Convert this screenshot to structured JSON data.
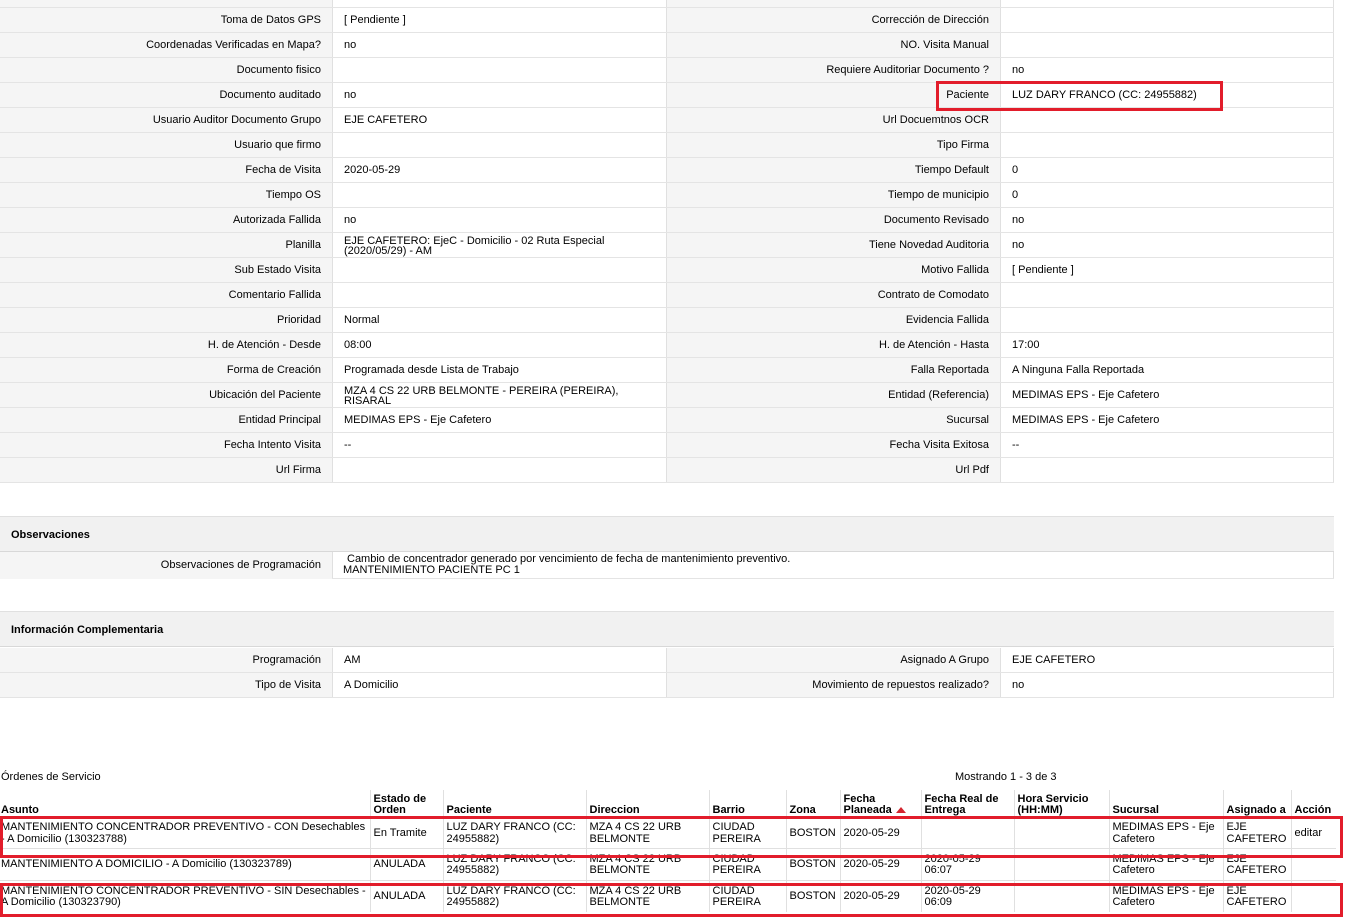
{
  "details": {
    "rows": [
      {
        "l1": "Toma de Datos GPS",
        "v1": "[ Pendiente ]",
        "l2": "Corrección de Dirección",
        "v2": ""
      },
      {
        "l1": "Coordenadas Verificadas en Mapa?",
        "v1": "no",
        "l2": "NO. Visita Manual",
        "v2": ""
      },
      {
        "l1": "Documento fisico",
        "v1": "",
        "l2": "Requiere Auditoriar Documento ?",
        "v2": "no"
      },
      {
        "l1": "Documento auditado",
        "v1": "no",
        "l2": "Paciente",
        "v2": "LUZ DARY FRANCO (CC: 24955882)"
      },
      {
        "l1": "Usuario Auditor Documento Grupo",
        "v1": "EJE CAFETERO",
        "l2": "Url Docuemtnos OCR",
        "v2": ""
      },
      {
        "l1": "Usuario que firmo",
        "v1": "",
        "l2": "Tipo Firma",
        "v2": ""
      },
      {
        "l1": "Fecha de Visita",
        "v1": "2020-05-29",
        "l2": "Tiempo Default",
        "v2": "0"
      },
      {
        "l1": "Tiempo OS",
        "v1": "",
        "l2": "Tiempo de municipio",
        "v2": "0"
      },
      {
        "l1": "Autorizada Fallida",
        "v1": "no",
        "l2": "Documento Revisado",
        "v2": "no"
      },
      {
        "l1": "Planilla",
        "v1": "EJE CAFETERO: EjeC - Domicilio - 02 Ruta Especial (2020/05/29) - AM",
        "l2": "Tiene Novedad Auditoria",
        "v2": "no"
      },
      {
        "l1": "Sub Estado Visita",
        "v1": "",
        "l2": "Motivo Fallida",
        "v2": "[ Pendiente ]"
      },
      {
        "l1": "Comentario Fallida",
        "v1": "",
        "l2": "Contrato de Comodato",
        "v2": ""
      },
      {
        "l1": "Prioridad",
        "v1": "Normal",
        "l2": "Evidencia Fallida",
        "v2": ""
      },
      {
        "l1": "H. de Atención - Desde",
        "v1": "08:00",
        "l2": "H. de Atención - Hasta",
        "v2": "17:00"
      },
      {
        "l1": "Forma de Creación",
        "v1": "Programada desde Lista de Trabajo",
        "l2": "Falla Reportada",
        "v2": "A Ninguna Falla Reportada"
      },
      {
        "l1": "Ubicación del Paciente",
        "v1": "MZA 4 CS 22 URB BELMONTE - PEREIRA (PEREIRA), RISARAL",
        "l2": "Entidad (Referencia)",
        "v2": "MEDIMAS EPS - Eje Cafetero"
      },
      {
        "l1": "Entidad Principal",
        "v1": "MEDIMAS EPS - Eje Cafetero",
        "l2": "Sucursal",
        "v2": "MEDIMAS EPS - Eje Cafetero"
      },
      {
        "l1": "Fecha Intento Visita",
        "v1": "--",
        "l2": "Fecha Visita Exitosa",
        "v2": "--"
      },
      {
        "l1": "Url Firma",
        "v1": "",
        "l2": "Url Pdf",
        "v2": ""
      }
    ]
  },
  "observaciones": {
    "title": "Observaciones",
    "label": "Observaciones de Programación",
    "line1": "Cambio de concentrador generado por vencimiento de fecha de mantenimiento preventivo.",
    "line2": "MANTENIMIENTO PACIENTE PC 1"
  },
  "complementaria": {
    "title": "Información Complementaria",
    "rows": [
      {
        "l1": "Programación",
        "v1": "AM",
        "l2": "Asignado A Grupo",
        "v2": "EJE CAFETERO"
      },
      {
        "l1": "Tipo de Visita",
        "v1": "A Domicilio",
        "l2": "Movimiento de repuestos realizado?",
        "v2": "no"
      }
    ]
  },
  "ordenes": {
    "title": "Órdenes de Servicio",
    "count": "Mostrando 1 - 3 de 3",
    "headers": [
      "Asunto",
      "Estado de Orden",
      "Paciente",
      "Direccion",
      "Barrio",
      "Zona",
      "Fecha Planeada",
      "Fecha Real de Entrega",
      "Hora Servicio (HH:MM)",
      "Sucursal",
      "Asignado a",
      "Acción"
    ],
    "rows": [
      {
        "asunto": "MANTENIMIENTO CONCENTRADOR PREVENTIVO - CON Desechables - A Domicilio (130323788)",
        "estado": "En Tramite",
        "paciente": "LUZ DARY FRANCO (CC: 24955882)",
        "direccion": "MZA 4 CS 22 URB BELMONTE",
        "barrio": "CIUDAD PEREIRA",
        "zona": "BOSTON",
        "fecha_planeada": "2020-05-29",
        "fecha_real": "",
        "hora": "",
        "sucursal": "MEDIMAS EPS - Eje Cafetero",
        "asignado": "EJE CAFETERO",
        "accion": "editar"
      },
      {
        "asunto": "MANTENIMIENTO A DOMICILIO - A Domicilio (130323789)",
        "estado": "ANULADA",
        "paciente": "LUZ DARY FRANCO (CC: 24955882)",
        "direccion": "MZA 4 CS 22 URB BELMONTE",
        "barrio": "CIUDAD PEREIRA",
        "zona": "BOSTON",
        "fecha_planeada": "2020-05-29",
        "fecha_real": "2020-05-29 06:07",
        "hora": "",
        "sucursal": "MEDIMAS EPS - Eje Cafetero",
        "asignado": "EJE CAFETERO",
        "accion": ""
      },
      {
        "asunto": "MANTENIMIENTO CONCENTRADOR PREVENTIVO - SIN Desechables - A Domicilio (130323790)",
        "estado": "ANULADA",
        "paciente": "LUZ DARY FRANCO (CC: 24955882)",
        "direccion": "MZA 4 CS 22 URB BELMONTE",
        "barrio": "CIUDAD PEREIRA",
        "zona": "BOSTON",
        "fecha_planeada": "2020-05-29",
        "fecha_real": "2020-05-29 06:09",
        "hora": "",
        "sucursal": "MEDIMAS EPS - Eje Cafetero",
        "asignado": "EJE CAFETERO",
        "accion": ""
      }
    ]
  },
  "colors": {
    "highlight": "#e21d2b",
    "label_bg": "#f5f5f5",
    "section_bg": "#f1f1f1"
  }
}
